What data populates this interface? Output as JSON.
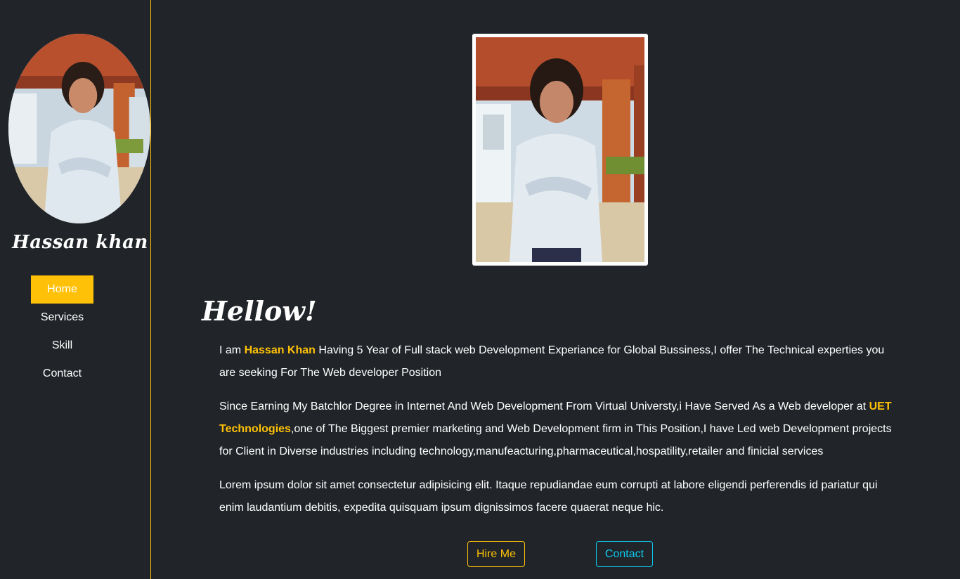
{
  "sidebar": {
    "name": "Hassan khan",
    "avatar_alt": "profile photo",
    "nav": [
      {
        "label": "Home",
        "active": true
      },
      {
        "label": "Services",
        "active": false
      },
      {
        "label": "Skill",
        "active": false
      },
      {
        "label": "Contact",
        "active": false
      }
    ]
  },
  "main": {
    "greeting": "Hellow!",
    "para1": {
      "prefix": "I am ",
      "name": "Hassan Khan",
      "rest": " Having 5 Year of Full stack web Development Experiance for Global Bussiness,I offer The Technical experties you are seeking For The Web developer Position"
    },
    "para2": {
      "prefix": "Since Earning My Batchlor Degree in Internet And Web Development From Virtual Universty,i Have Served As a Web developer at ",
      "company": "UET Technologies",
      "rest": ",one of The Biggest premier marketing and Web Development firm in This Position,I have Led web Development projects for Client in Diverse industries including technology,manufeacturing,pharmaceutical,hospatility,retailer and finicial services"
    },
    "para3": "Lorem ipsum dolor sit amet consectetur adipisicing elit. Itaque repudiandae eum corrupti at labore eligendi perferendis id pariatur qui enim laudantium debitis, expedita quisquam ipsum dignissimos facere quaerat neque hic.",
    "buttons": {
      "hire": "Hire Me",
      "contact": "Contact"
    }
  },
  "colors": {
    "background": "#212529",
    "accent": "#ffc107",
    "info": "#0dcaf0"
  }
}
